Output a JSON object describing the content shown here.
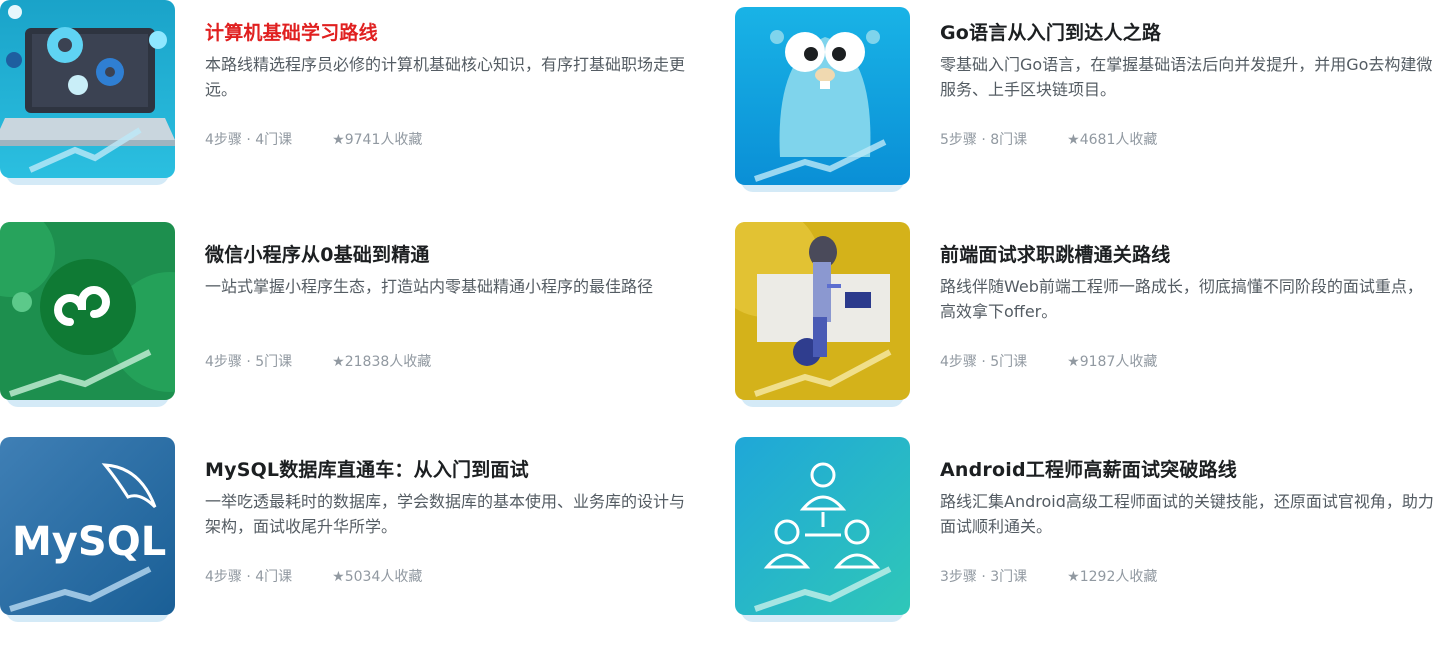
{
  "cards": [
    {
      "title": "计算机基础学习路线",
      "desc": "本路线精选程序员必修的计算机基础核心知识，有序打基础职场走更远。",
      "steps": "4步骤 · 4门课",
      "collect": "★9741人收藏"
    },
    {
      "title": "Go语言从入门到达人之路",
      "desc": "零基础入门Go语言，在掌握基础语法后向并发提升，并用Go去构建微服务、上手区块链项目。",
      "steps": "5步骤 · 8门课",
      "collect": "★4681人收藏"
    },
    {
      "title": "微信小程序从0基础到精通",
      "desc": "一站式掌握小程序生态，打造站内零基础精通小程序的最佳路径",
      "steps": "4步骤 · 5门课",
      "collect": "★21838人收藏"
    },
    {
      "title": "前端面试求职跳槽通关路线",
      "desc": "路线伴随Web前端工程师一路成长，彻底搞懂不同阶段的面试重点，高效拿下offer。",
      "steps": "4步骤 · 5门课",
      "collect": "★9187人收藏"
    },
    {
      "title": "MySQL数据库直通车：从入门到面试",
      "desc": "一举吃透最耗时的数据库，学会数据库的基本使用、业务库的设计与架构，面试收尾升华所学。",
      "steps": "4步骤 · 4门课",
      "collect": "★5034人收藏"
    },
    {
      "title": "Android工程师高薪面试突破路线",
      "desc": "路线汇集Android高级工程师面试的关键技能，还原面试官视角，助力面试顺利通关。",
      "steps": "3步骤 · 3门课",
      "collect": "★1292人收藏"
    }
  ],
  "thumb_text": {
    "mysql": "MySQL"
  },
  "colors": {
    "active_title": "#e02020",
    "title": "#1c1f21",
    "desc": "#545c63",
    "meta": "#9199a1"
  }
}
